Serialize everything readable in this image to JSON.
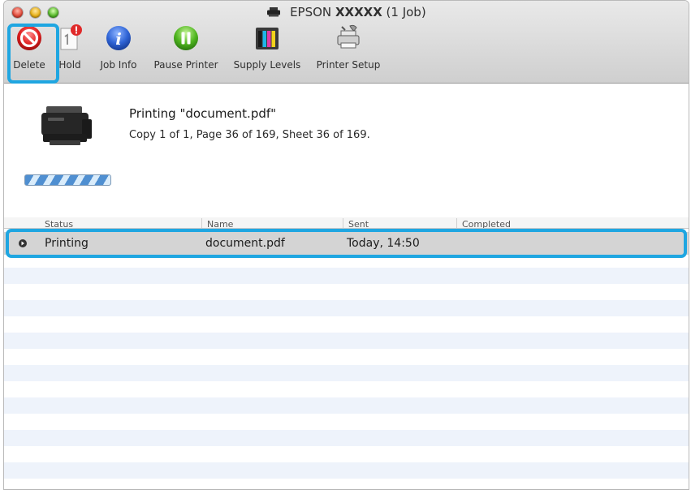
{
  "window": {
    "title_prefix": "EPSON",
    "title_model": "XXXXX",
    "title_suffix": "(1 Job)"
  },
  "toolbar": {
    "delete_label": "Delete",
    "hold_label": "Hold",
    "job_info_label": "Job Info",
    "pause_label": "Pause Printer",
    "supply_label": "Supply Levels",
    "setup_label": "Printer Setup"
  },
  "status": {
    "line1": "Printing \"document.pdf\"",
    "line2": "Copy 1 of 1, Page 36 of 169, Sheet 36 of 169.",
    "progress_fraction": 1.0
  },
  "table": {
    "columns": [
      "Status",
      "Name",
      "Sent",
      "Completed"
    ],
    "rows": [
      {
        "status": "Printing",
        "name": "document.pdf",
        "sent": "Today, 14:50",
        "completed": ""
      }
    ]
  },
  "colors": {
    "highlight": "#1fa6e1",
    "stripe": "#eef3fb",
    "selected_row": "#d4d4d4"
  }
}
